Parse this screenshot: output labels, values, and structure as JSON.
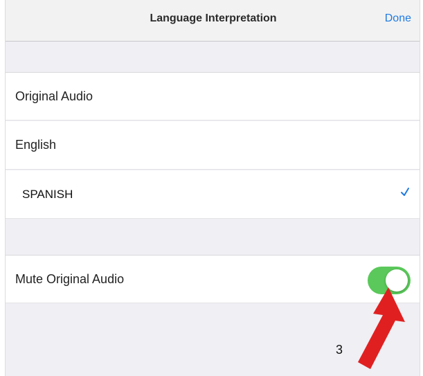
{
  "navbar": {
    "title": "Language Interpretation",
    "done_label": "Done"
  },
  "languages": [
    {
      "label": "Original Audio",
      "selected": false
    },
    {
      "label": "English",
      "selected": false
    },
    {
      "label": "SPANISH",
      "selected": true
    }
  ],
  "settings": {
    "mute_label": "Mute Original Audio",
    "mute_enabled": true
  },
  "annotation": {
    "number": "3",
    "arrow_color": "#e02020"
  },
  "colors": {
    "accent": "#1f7ae0",
    "toggle_on": "#5ac85a",
    "group_background": "#efeff4"
  },
  "icons": {
    "selected_indicator": "checkmark-icon",
    "callout": "arrow-icon"
  }
}
